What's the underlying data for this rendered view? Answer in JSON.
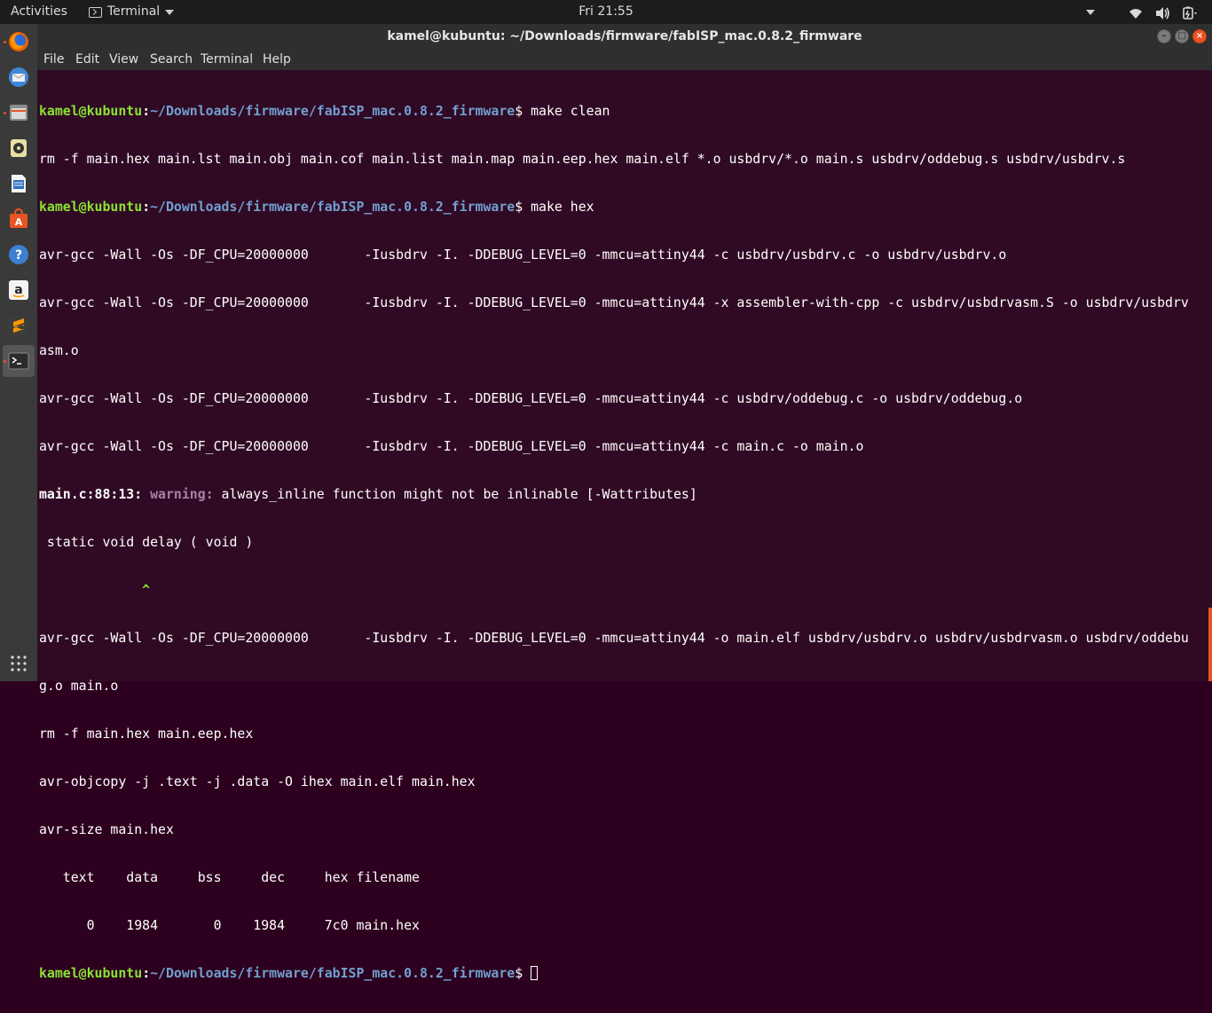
{
  "topbar": {
    "activities": "Activities",
    "app_name": "Terminal",
    "clock": "Fri 21:55"
  },
  "window": {
    "title": "kamel@kubuntu: ~/Downloads/firmware/fabISP_mac.0.8.2_firmware"
  },
  "menubar": {
    "file": "File",
    "edit": "Edit",
    "view": "View",
    "search": "Search",
    "terminal": "Terminal",
    "help": "Help"
  },
  "terminal": {
    "prompt_user": "kamel@kubuntu",
    "prompt_sep": ":",
    "prompt_path": "~/Downloads/firmware/fabISP_mac.0.8.2_firmware",
    "prompt_suffix": "$ ",
    "cmd1": "make clean",
    "out1": "rm -f main.hex main.lst main.obj main.cof main.list main.map main.eep.hex main.elf *.o usbdrv/*.o main.s usbdrv/oddebug.s usbdrv/usbdrv.s",
    "cmd2": "make hex",
    "out2": "avr-gcc -Wall -Os -DF_CPU=20000000       -Iusbdrv -I. -DDEBUG_LEVEL=0 -mmcu=attiny44 -c usbdrv/usbdrv.c -o usbdrv/usbdrv.o",
    "out3a": "avr-gcc -Wall -Os -DF_CPU=20000000       -Iusbdrv -I. -DDEBUG_LEVEL=0 -mmcu=attiny44 -x assembler-with-cpp -c usbdrv/usbdrvasm.S -o usbdrv/usbdrv",
    "out3b": "asm.o",
    "out4": "avr-gcc -Wall -Os -DF_CPU=20000000       -Iusbdrv -I. -DDEBUG_LEVEL=0 -mmcu=attiny44 -c usbdrv/oddebug.c -o usbdrv/oddebug.o",
    "out5": "avr-gcc -Wall -Os -DF_CPU=20000000       -Iusbdrv -I. -DDEBUG_LEVEL=0 -mmcu=attiny44 -c main.c -o main.o",
    "warn_loc": "main.c:88:13:",
    "warn_label": "warning:",
    "warn_msg": " always_inline function might not be inlinable [-Wattributes]",
    "warn_code": " static void delay ( void )",
    "warn_caret": "             ^",
    "out6a": "avr-gcc -Wall -Os -DF_CPU=20000000       -Iusbdrv -I. -DDEBUG_LEVEL=0 -mmcu=attiny44 -o main.elf usbdrv/usbdrv.o usbdrv/usbdrvasm.o usbdrv/oddebu",
    "out6b": "g.o main.o",
    "out7": "rm -f main.hex main.eep.hex",
    "out8": "avr-objcopy -j .text -j .data -O ihex main.elf main.hex",
    "out9": "avr-size main.hex",
    "size_header": "   text    data     bss     dec     hex filename",
    "size_row": "      0    1984       0    1984     7c0 main.hex"
  },
  "dock": {
    "items": [
      "firefox-icon",
      "thunderbird-icon",
      "files-icon",
      "rhythmbox-icon",
      "libreoffice-writer-icon",
      "software-center-icon",
      "help-icon",
      "amazon-icon",
      "sublime-text-icon",
      "terminal-icon"
    ],
    "apps_grid": "show-applications-icon"
  },
  "colors": {
    "terminal_bg": "#300a24",
    "prompt_user": "#8ae234",
    "prompt_path": "#729fcf",
    "warning": "#ad7fa8",
    "accent": "#e95420"
  }
}
